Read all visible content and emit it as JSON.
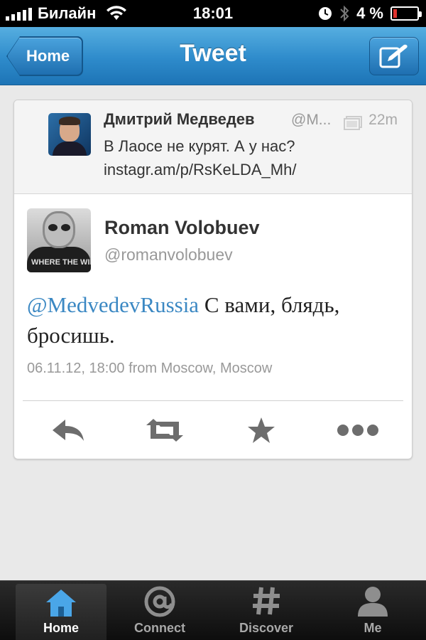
{
  "status_bar": {
    "carrier": "Билайн",
    "time": "18:01",
    "battery_percent": "4 %",
    "battery_level": 0.04
  },
  "nav": {
    "back_label": "Home",
    "title": "Tweet",
    "compose_icon": "compose-icon"
  },
  "parent_tweet": {
    "author_name": "Дмитрий Медведев",
    "handle": "@M...",
    "time": "22m",
    "text_line1": "В Лаосе не курят. А у нас?",
    "text_line2": "instagr.am/p/RsKeLDA_Mh/"
  },
  "tweet": {
    "author_name": "Roman Volobuev",
    "handle": "@romanvolobuev",
    "mention": "@MedvedevRussia",
    "text": " С вами, блядь, бросишь.",
    "meta": "06.11.12, 18:00 from Moscow, Moscow",
    "avatar_shirt_text": "WHERE THE WILD"
  },
  "actions": [
    "reply-icon",
    "retweet-icon",
    "favorite-icon",
    "more-icon"
  ],
  "tabs": [
    {
      "label": "Home",
      "icon": "home-icon",
      "active": true
    },
    {
      "label": "Connect",
      "icon": "at-icon",
      "active": false
    },
    {
      "label": "Discover",
      "icon": "hashtag-icon",
      "active": false
    },
    {
      "label": "Me",
      "icon": "person-icon",
      "active": false
    }
  ],
  "colors": {
    "nav_blue": "#2e8bcb",
    "mention_blue": "#3b88c3",
    "battery_red": "#e0322d",
    "active_tab_icon": "#4aa6e8"
  }
}
